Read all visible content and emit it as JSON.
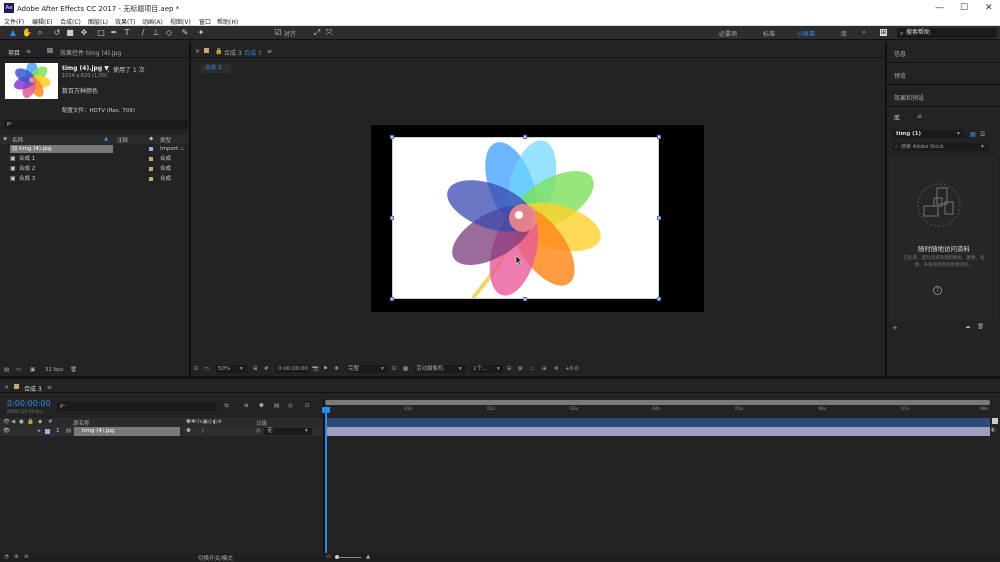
{
  "title_bar": {
    "app_logo": "Ae",
    "title": "Adobe After Effects CC 2017 - 无标题项目.aep *"
  },
  "menu": [
    "文件(F)",
    "编辑(E)",
    "合成(C)",
    "图层(L)",
    "效果(T)",
    "动画(A)",
    "视图(V)",
    "窗口",
    "帮助(H)"
  ],
  "toolbar": {
    "align_label": "对齐",
    "workspaces": [
      "必要项",
      "标准",
      "小屏幕",
      "库"
    ],
    "active_workspace": "小屏幕",
    "search_placeholder": "搜索帮助"
  },
  "project_panel": {
    "tab_project": "项目",
    "tab_effects": "效果控件 timg (4).jpg",
    "asset_name": "timg (4).jpg ▼",
    "asset_usage": "，使用了 1 次",
    "asset_dims": "1024 x 620 (1.00)",
    "asset_color": "数百万种颜色",
    "asset_profile": "配置文件：HDTV (Rec. 709)",
    "search_placeholder": "ρ-",
    "columns": {
      "name": "名称",
      "comment": "注释",
      "type": "类型"
    },
    "items": [
      {
        "name": "timg (4).jpg",
        "type": "Import",
        "selected": true
      },
      {
        "name": "合成 1",
        "type": "合成"
      },
      {
        "name": "合成 2",
        "type": "合成"
      },
      {
        "name": "合成 3",
        "type": "合成"
      }
    ],
    "footer_bpc": "32 bpc"
  },
  "composition_panel": {
    "tab_label": "合成 3",
    "breadcrumb": "合成 3",
    "footer": {
      "zoom": "50%",
      "timecode": "0:00:00:00",
      "resolution": "完整",
      "camera": "活动摄像机",
      "views": "1个...",
      "exposure": "+0.0"
    }
  },
  "right_panel": {
    "sections": [
      "信息",
      "预览",
      "效果和预设",
      "库"
    ],
    "library_name": "timg (1)",
    "stock_placeholder": "搜索 Adobe Stock",
    "promo_title": "随时随地访问资料",
    "promo_text": "在此库、面对话将资源和图色、图像、视频、升帐和其他获取性资料。",
    "help_icon": "?"
  },
  "timeline": {
    "tab_label": "合成 3",
    "timecode": "0:00:00:00",
    "frame_info": "00000 (25.00 fps)",
    "search_placeholder": "ρ-",
    "columns": {
      "source": "源名称",
      "parent": "父级"
    },
    "ruler": [
      "0s",
      "01s",
      "02s",
      "03s",
      "04s",
      "05s",
      "06s",
      "07s",
      "08s"
    ],
    "layers": [
      {
        "index": "1",
        "name": "timg (4).jpg",
        "parent": "无"
      }
    ],
    "footer_label": "切换开关/模式"
  },
  "colors": {
    "accent": "#2d8ceb",
    "layer_bar": "#9e9ec0",
    "selected_row": "#7a7a7a"
  }
}
